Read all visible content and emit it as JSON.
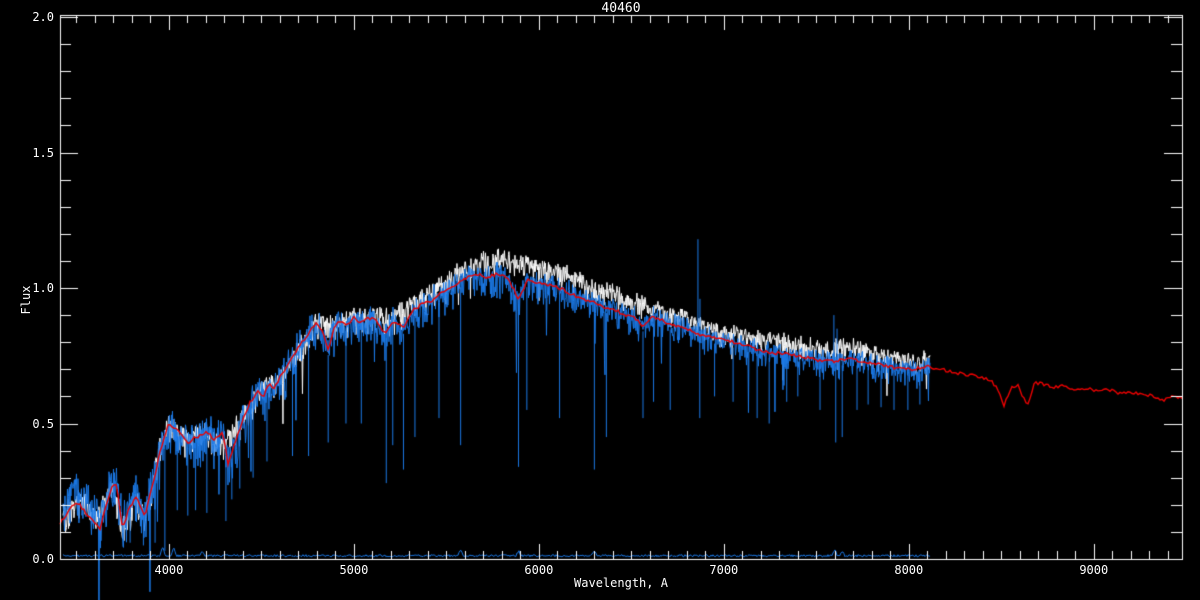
{
  "title": "40460",
  "axes": {
    "xlabel": "Wavelength, A",
    "ylabel": "Flux",
    "xtick_labels": [
      "4000",
      "5000",
      "6000",
      "7000",
      "8000",
      "9000"
    ],
    "ytick_labels": [
      "0.0",
      "0.5",
      "1.0",
      "1.5",
      "2.0"
    ]
  },
  "colors": {
    "background": "#000000",
    "axis": "#ffffff",
    "observed": "#ffffff",
    "fit": "#1b79e6",
    "template": "#eb0000",
    "text": "#ffffff"
  },
  "chart_data": {
    "type": "line",
    "title": "40460",
    "xlabel": "Wavelength, A",
    "ylabel": "Flux",
    "xlim": [
      3411,
      9477
    ],
    "ylim": [
      0,
      2.0
    ],
    "xticks": [
      4000,
      5000,
      6000,
      7000,
      8000,
      9000
    ],
    "yticks": [
      0.0,
      0.5,
      1.0,
      1.5,
      2.0
    ],
    "x_minor_interval": 100,
    "y_minor_interval": 0.1,
    "grid": false,
    "legend": "none",
    "series": [
      {
        "name": "observed spectrum",
        "role": "observed",
        "color_key": "observed",
        "x_range": [
          3427,
          8115
        ],
        "baseline": [
          [
            3427,
            0.17
          ],
          [
            3530,
            0.22
          ],
          [
            3600,
            0.15
          ],
          [
            3700,
            0.27
          ],
          [
            3750,
            0.13
          ],
          [
            3826,
            0.23
          ],
          [
            3870,
            0.16
          ],
          [
            3950,
            0.4
          ],
          [
            4000,
            0.5
          ],
          [
            4100,
            0.44
          ],
          [
            4200,
            0.47
          ],
          [
            4300,
            0.42
          ],
          [
            4400,
            0.53
          ],
          [
            4500,
            0.62
          ],
          [
            4600,
            0.67
          ],
          [
            4700,
            0.78
          ],
          [
            4800,
            0.87
          ],
          [
            4900,
            0.86
          ],
          [
            5000,
            0.89
          ],
          [
            5100,
            0.9
          ],
          [
            5200,
            0.88
          ],
          [
            5300,
            0.93
          ],
          [
            5400,
            0.97
          ],
          [
            5500,
            1.02
          ],
          [
            5600,
            1.07
          ],
          [
            5700,
            1.1
          ],
          [
            5800,
            1.11
          ],
          [
            5900,
            1.09
          ],
          [
            6000,
            1.08
          ],
          [
            6100,
            1.06
          ],
          [
            6200,
            1.03
          ],
          [
            6300,
            1.0
          ],
          [
            6400,
            0.98
          ],
          [
            6500,
            0.95
          ],
          [
            6600,
            0.93
          ],
          [
            6700,
            0.91
          ],
          [
            6800,
            0.89
          ],
          [
            6900,
            0.86
          ],
          [
            7000,
            0.84
          ],
          [
            7100,
            0.83
          ],
          [
            7200,
            0.81
          ],
          [
            7300,
            0.8
          ],
          [
            7400,
            0.79
          ],
          [
            7500,
            0.78
          ],
          [
            7600,
            0.78
          ],
          [
            7700,
            0.78
          ],
          [
            7800,
            0.76
          ],
          [
            7900,
            0.74
          ],
          [
            8000,
            0.73
          ],
          [
            8115,
            0.74
          ]
        ],
        "noise_spread": [
          [
            3427,
            0.055
          ],
          [
            4400,
            0.05
          ],
          [
            5300,
            0.045
          ],
          [
            6500,
            0.04
          ],
          [
            8115,
            0.04
          ]
        ],
        "noise_seed": 101,
        "spike_prob": 0.008,
        "spike_depth": [
          1.5,
          2.5
        ]
      },
      {
        "name": "fitted spectrum overplot",
        "role": "fit",
        "color_key": "fit",
        "x_range": [
          3427,
          8115
        ],
        "baseline": "template",
        "baseline_offset": [
          [
            3427,
            0.05
          ],
          [
            3650,
            0.03
          ],
          [
            3950,
            0.0
          ],
          [
            8115,
            0.0
          ]
        ],
        "noise_spread": [
          [
            3427,
            0.085
          ],
          [
            4000,
            0.08
          ],
          [
            4400,
            0.075
          ],
          [
            4800,
            0.065
          ],
          [
            5300,
            0.06
          ],
          [
            5800,
            0.055
          ],
          [
            6500,
            0.05
          ],
          [
            7200,
            0.047
          ],
          [
            8115,
            0.045
          ]
        ],
        "noise_seed": 202,
        "spike_prob": 0.015,
        "spike_depth": [
          1.8,
          3.5
        ],
        "down_spikes": [
          [
            3630,
            0.04
          ],
          [
            3790,
            0.06
          ],
          [
            3862,
            0.05
          ],
          [
            3925,
            0.06
          ],
          [
            3978,
            0.03
          ],
          [
            4045,
            0.18
          ],
          [
            4102,
            0.16
          ],
          [
            4144,
            0.18
          ],
          [
            4205,
            0.17
          ],
          [
            4308,
            0.14
          ],
          [
            4340,
            0.22
          ],
          [
            4383,
            0.26
          ],
          [
            4455,
            0.3
          ],
          [
            4530,
            0.36
          ],
          [
            4668,
            0.38
          ],
          [
            4755,
            0.38
          ],
          [
            4861,
            0.43
          ],
          [
            4957,
            0.5
          ],
          [
            5040,
            0.5
          ],
          [
            5175,
            0.28
          ],
          [
            5210,
            0.42
          ],
          [
            5268,
            0.33
          ],
          [
            5330,
            0.45
          ],
          [
            5460,
            0.52
          ],
          [
            5577,
            0.42
          ],
          [
            5890,
            0.34
          ],
          [
            5935,
            0.55
          ],
          [
            6112,
            0.52
          ],
          [
            6300,
            0.33
          ],
          [
            6365,
            0.45
          ],
          [
            6563,
            0.52
          ],
          [
            6620,
            0.58
          ],
          [
            6710,
            0.55
          ],
          [
            6870,
            0.52
          ],
          [
            6950,
            0.6
          ],
          [
            7050,
            0.58
          ],
          [
            7180,
            0.52
          ],
          [
            7245,
            0.5
          ],
          [
            7340,
            0.58
          ],
          [
            7400,
            0.6
          ],
          [
            7520,
            0.55
          ],
          [
            7605,
            0.43
          ],
          [
            7640,
            0.45
          ],
          [
            7720,
            0.55
          ],
          [
            7780,
            0.57
          ],
          [
            7850,
            0.56
          ],
          [
            7920,
            0.55
          ],
          [
            7995,
            0.55
          ],
          [
            8060,
            0.57
          ]
        ],
        "up_spikes": [
          [
            6860,
            1.18
          ],
          [
            6871,
            0.96
          ],
          [
            7595,
            0.9
          ],
          [
            7612,
            0.85
          ]
        ]
      },
      {
        "name": "error spectrum",
        "role": "error",
        "color_key": "fit",
        "x_range": [
          3427,
          8115
        ],
        "level": 0.012,
        "noise": 0.004,
        "noise_seed": 303,
        "bumps": [
          [
            3965,
            0.035
          ],
          [
            4025,
            0.03
          ],
          [
            4180,
            0.02
          ],
          [
            5577,
            0.02
          ],
          [
            5890,
            0.018
          ],
          [
            6300,
            0.018
          ],
          [
            7600,
            0.02
          ],
          [
            7640,
            0.018
          ]
        ]
      },
      {
        "name": "template spectrum",
        "role": "template",
        "color_key": "template",
        "x_range": [
          3411,
          9477
        ],
        "points": [
          [
            3411,
            0.13
          ],
          [
            3440,
            0.16
          ],
          [
            3470,
            0.19
          ],
          [
            3500,
            0.21
          ],
          [
            3530,
            0.19
          ],
          [
            3560,
            0.16
          ],
          [
            3590,
            0.14
          ],
          [
            3627,
            0.11
          ],
          [
            3660,
            0.2
          ],
          [
            3690,
            0.26
          ],
          [
            3715,
            0.28
          ],
          [
            3750,
            0.11
          ],
          [
            3780,
            0.18
          ],
          [
            3826,
            0.23
          ],
          [
            3870,
            0.15
          ],
          [
            3900,
            0.25
          ],
          [
            3925,
            0.3
          ],
          [
            3945,
            0.38
          ],
          [
            3970,
            0.44
          ],
          [
            4000,
            0.5
          ],
          [
            4050,
            0.47
          ],
          [
            4100,
            0.43
          ],
          [
            4150,
            0.45
          ],
          [
            4200,
            0.47
          ],
          [
            4250,
            0.44
          ],
          [
            4290,
            0.47
          ],
          [
            4320,
            0.35
          ],
          [
            4360,
            0.43
          ],
          [
            4400,
            0.52
          ],
          [
            4440,
            0.58
          ],
          [
            4480,
            0.62
          ],
          [
            4510,
            0.6
          ],
          [
            4540,
            0.65
          ],
          [
            4570,
            0.63
          ],
          [
            4600,
            0.67
          ],
          [
            4650,
            0.72
          ],
          [
            4700,
            0.78
          ],
          [
            4730,
            0.81
          ],
          [
            4760,
            0.84
          ],
          [
            4800,
            0.87
          ],
          [
            4830,
            0.84
          ],
          [
            4860,
            0.77
          ],
          [
            4890,
            0.85
          ],
          [
            4920,
            0.88
          ],
          [
            4960,
            0.86
          ],
          [
            5000,
            0.89
          ],
          [
            5040,
            0.87
          ],
          [
            5080,
            0.89
          ],
          [
            5120,
            0.88
          ],
          [
            5170,
            0.83
          ],
          [
            5210,
            0.88
          ],
          [
            5270,
            0.85
          ],
          [
            5320,
            0.92
          ],
          [
            5370,
            0.94
          ],
          [
            5420,
            0.95
          ],
          [
            5470,
            0.98
          ],
          [
            5520,
            1.0
          ],
          [
            5570,
            1.02
          ],
          [
            5620,
            1.04
          ],
          [
            5670,
            1.05
          ],
          [
            5720,
            1.04
          ],
          [
            5770,
            1.05
          ],
          [
            5830,
            1.04
          ],
          [
            5890,
            0.96
          ],
          [
            5940,
            1.03
          ],
          [
            5990,
            1.02
          ],
          [
            6050,
            1.01
          ],
          [
            6110,
            1.0
          ],
          [
            6170,
            0.98
          ],
          [
            6230,
            0.96
          ],
          [
            6290,
            0.95
          ],
          [
            6350,
            0.93
          ],
          [
            6410,
            0.92
          ],
          [
            6470,
            0.9
          ],
          [
            6520,
            0.89
          ],
          [
            6563,
            0.86
          ],
          [
            6610,
            0.89
          ],
          [
            6670,
            0.88
          ],
          [
            6730,
            0.86
          ],
          [
            6790,
            0.85
          ],
          [
            6860,
            0.83
          ],
          [
            6920,
            0.82
          ],
          [
            6980,
            0.81
          ],
          [
            7050,
            0.8
          ],
          [
            7120,
            0.79
          ],
          [
            7190,
            0.77
          ],
          [
            7260,
            0.76
          ],
          [
            7330,
            0.76
          ],
          [
            7400,
            0.75
          ],
          [
            7470,
            0.74
          ],
          [
            7540,
            0.73
          ],
          [
            7610,
            0.73
          ],
          [
            7680,
            0.74
          ],
          [
            7750,
            0.73
          ],
          [
            7820,
            0.72
          ],
          [
            7890,
            0.71
          ],
          [
            7960,
            0.7
          ],
          [
            8030,
            0.7
          ],
          [
            8100,
            0.71
          ],
          [
            8170,
            0.7
          ],
          [
            8240,
            0.69
          ],
          [
            8310,
            0.68
          ],
          [
            8380,
            0.675
          ],
          [
            8440,
            0.66
          ],
          [
            8480,
            0.63
          ],
          [
            8515,
            0.565
          ],
          [
            8550,
            0.63
          ],
          [
            8590,
            0.645
          ],
          [
            8640,
            0.56
          ],
          [
            8680,
            0.65
          ],
          [
            8730,
            0.645
          ],
          [
            8780,
            0.635
          ],
          [
            8840,
            0.64
          ],
          [
            8900,
            0.625
          ],
          [
            8960,
            0.63
          ],
          [
            9020,
            0.62
          ],
          [
            9080,
            0.625
          ],
          [
            9140,
            0.61
          ],
          [
            9200,
            0.615
          ],
          [
            9260,
            0.61
          ],
          [
            9320,
            0.6
          ],
          [
            9380,
            0.585
          ],
          [
            9430,
            0.6
          ],
          [
            9477,
            0.595
          ]
        ],
        "jitter": 0.012,
        "noise_seed": 404
      }
    ]
  }
}
